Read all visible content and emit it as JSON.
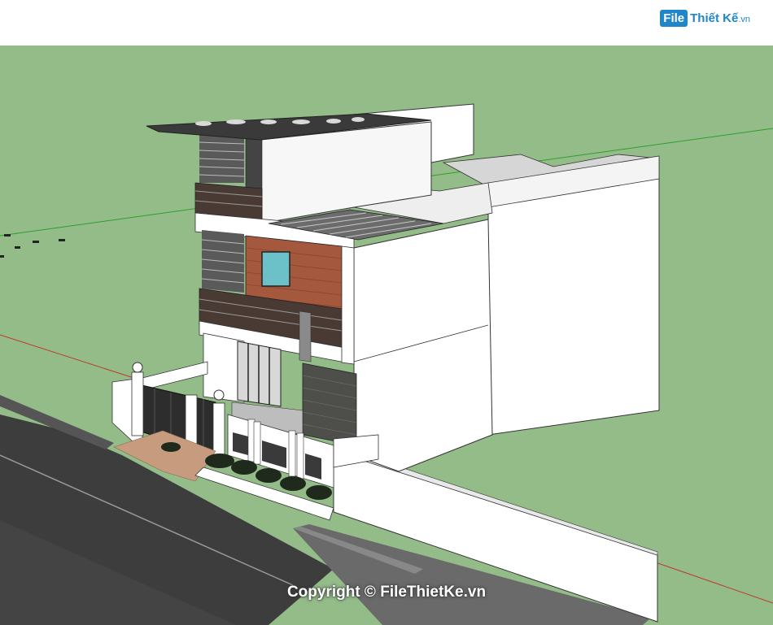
{
  "brand": {
    "badge": "File",
    "name": "Thiết Kế",
    "tld": ".vn"
  },
  "watermark": "Copyright © FileThietKe.vn",
  "icons": {
    "logo": "file-folder-icon"
  },
  "colors": {
    "sky": "#ffffff",
    "ground": "#94bc89",
    "road": "#3b3b3b",
    "wall": "#ffffff",
    "wood": "#a4583d",
    "stone": "#4e4e4a",
    "green_axis": "#2c9f2c",
    "red_axis": "#c0392b",
    "brand_blue": "#1f86c9"
  }
}
